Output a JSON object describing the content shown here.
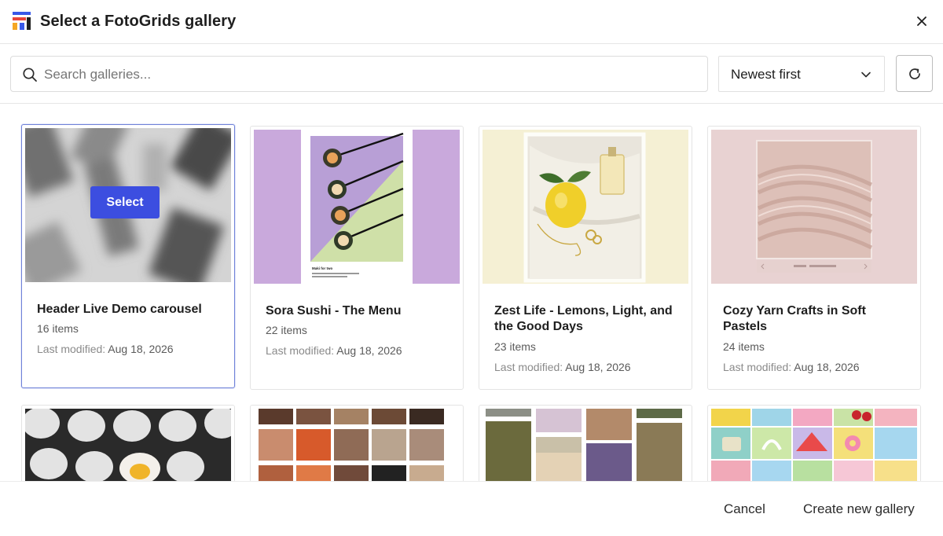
{
  "header": {
    "title": "Select a FotoGrids gallery",
    "logo_colors": [
      "#3858e9",
      "#e8453c",
      "#f5a623",
      "#1e1e1e"
    ]
  },
  "toolbar": {
    "search_placeholder": "Search galleries...",
    "search_value": "",
    "sort_selected": "Newest first"
  },
  "galleries": [
    {
      "title": "Header Live Demo carousel",
      "count": "16 items",
      "modified_label": "Last modified:",
      "modified_date": "Aug 18, 2026",
      "selected": true,
      "hover_label": "Select"
    },
    {
      "title": "Sora Sushi - The Menu",
      "count": "22 items",
      "modified_label": "Last modified:",
      "modified_date": "Aug 18, 2026",
      "thumb_caption": "Maki for two"
    },
    {
      "title": "Zest Life - Lemons, Light, and the Good Days",
      "count": "23 items",
      "modified_label": "Last modified:",
      "modified_date": "Aug 18, 2026"
    },
    {
      "title": "Cozy Yarn Crafts in Soft Pastels",
      "count": "24 items",
      "modified_label": "Last modified:",
      "modified_date": "Aug 18, 2026"
    }
  ],
  "footer": {
    "cancel_label": "Cancel",
    "create_label": "Create new gallery"
  },
  "colors": {
    "accent": "#3c4ee0",
    "selected_border": "#6f82d8"
  }
}
